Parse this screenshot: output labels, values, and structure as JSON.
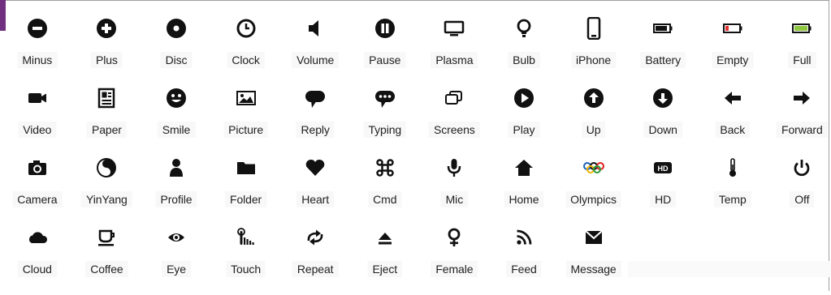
{
  "icons": {
    "row1": [
      {
        "label": "Minus",
        "icon": "minus-icon"
      },
      {
        "label": "Plus",
        "icon": "plus-icon"
      },
      {
        "label": "Disc",
        "icon": "disc-icon"
      },
      {
        "label": "Clock",
        "icon": "clock-icon"
      },
      {
        "label": "Volume",
        "icon": "volume-icon"
      },
      {
        "label": "Pause",
        "icon": "pause-icon"
      },
      {
        "label": "Plasma",
        "icon": "plasma-icon"
      },
      {
        "label": "Bulb",
        "icon": "bulb-icon"
      },
      {
        "label": "iPhone",
        "icon": "iphone-icon"
      },
      {
        "label": "Battery",
        "icon": "battery-icon"
      },
      {
        "label": "Empty",
        "icon": "battery-empty-icon"
      },
      {
        "label": "Full",
        "icon": "battery-full-icon"
      }
    ],
    "row2": [
      {
        "label": "Video",
        "icon": "video-icon"
      },
      {
        "label": "Paper",
        "icon": "paper-icon"
      },
      {
        "label": "Smile",
        "icon": "smile-icon"
      },
      {
        "label": "Picture",
        "icon": "picture-icon"
      },
      {
        "label": "Reply",
        "icon": "reply-icon"
      },
      {
        "label": "Typing",
        "icon": "typing-icon"
      },
      {
        "label": "Screens",
        "icon": "screens-icon"
      },
      {
        "label": "Play",
        "icon": "play-icon"
      },
      {
        "label": "Up",
        "icon": "up-icon"
      },
      {
        "label": "Down",
        "icon": "down-icon"
      },
      {
        "label": "Back",
        "icon": "back-icon"
      },
      {
        "label": "Forward",
        "icon": "forward-icon"
      }
    ],
    "row3": [
      {
        "label": "Camera",
        "icon": "camera-icon"
      },
      {
        "label": "YinYang",
        "icon": "yinyang-icon"
      },
      {
        "label": "Profile",
        "icon": "profile-icon"
      },
      {
        "label": "Folder",
        "icon": "folder-icon"
      },
      {
        "label": "Heart",
        "icon": "heart-icon"
      },
      {
        "label": "Cmd",
        "icon": "cmd-icon"
      },
      {
        "label": "Mic",
        "icon": "mic-icon"
      },
      {
        "label": "Home",
        "icon": "home-icon"
      },
      {
        "label": "Olympics",
        "icon": "olympics-icon"
      },
      {
        "label": "HD",
        "icon": "hd-icon"
      },
      {
        "label": "Temp",
        "icon": "temp-icon"
      },
      {
        "label": "Off",
        "icon": "off-icon"
      }
    ],
    "row4": [
      {
        "label": "Cloud",
        "icon": "cloud-icon"
      },
      {
        "label": "Coffee",
        "icon": "coffee-icon"
      },
      {
        "label": "Eye",
        "icon": "eye-icon"
      },
      {
        "label": "Touch",
        "icon": "touch-icon"
      },
      {
        "label": "Repeat",
        "icon": "repeat-icon"
      },
      {
        "label": "Eject",
        "icon": "eject-icon"
      },
      {
        "label": "Female",
        "icon": "female-icon"
      },
      {
        "label": "Feed",
        "icon": "feed-icon"
      },
      {
        "label": "Message",
        "icon": "message-icon"
      }
    ]
  },
  "colors": {
    "accent": "#70307f",
    "icon": "#111111",
    "battery_empty_fill": "#e03030",
    "battery_full_fill": "#8dc63f",
    "olympic_blue": "#1a63b5",
    "olympic_red": "#e02020",
    "olympic_green": "#2a9a3a",
    "olympic_yellow": "#f0b400"
  }
}
